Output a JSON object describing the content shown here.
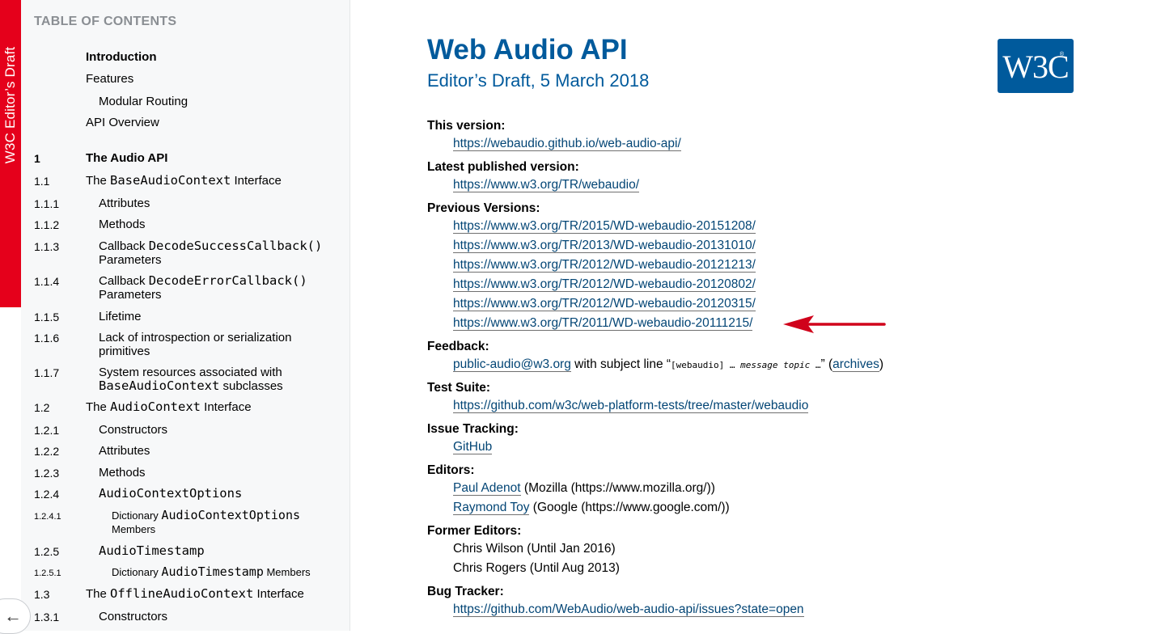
{
  "side_logo": {
    "text": "W3C Editor’s Draft",
    "color": "#e5001b"
  },
  "toc": {
    "heading": "TABLE OF CONTENTS",
    "items": [
      {
        "num": "",
        "text": "Introduction"
      },
      {
        "num": "",
        "text": "Features"
      },
      {
        "num": "",
        "text": "Modular Routing"
      },
      {
        "num": "",
        "text": "API Overview"
      },
      {
        "num": "1",
        "text": "The Audio API"
      },
      {
        "num": "1.1",
        "pre": "The ",
        "code": "BaseAudioContext",
        "post": " Interface"
      },
      {
        "num": "1.1.1",
        "text": "Attributes"
      },
      {
        "num": "1.1.2",
        "text": "Methods"
      },
      {
        "num": "1.1.3",
        "pre": "Callback ",
        "code": "DecodeSuccessCallback()",
        "post": " Parameters"
      },
      {
        "num": "1.1.4",
        "pre": "Callback ",
        "code": "DecodeErrorCallback()",
        "post": " Parameters"
      },
      {
        "num": "1.1.5",
        "text": "Lifetime"
      },
      {
        "num": "1.1.6",
        "text": "Lack of introspection or serialization primitives"
      },
      {
        "num": "1.1.7",
        "pre": "System resources associated with ",
        "code": "BaseAudioContext",
        "post": " subclasses"
      },
      {
        "num": "1.2",
        "pre": "The ",
        "code": "AudioContext",
        "post": " Interface"
      },
      {
        "num": "1.2.1",
        "text": "Constructors"
      },
      {
        "num": "1.2.2",
        "text": "Attributes"
      },
      {
        "num": "1.2.3",
        "text": "Methods"
      },
      {
        "num": "1.2.4",
        "code": "AudioContextOptions"
      },
      {
        "num": "1.2.4.1",
        "pre": "Dictionary ",
        "code": "AudioContextOptions",
        "post": " Members"
      },
      {
        "num": "1.2.5",
        "code": "AudioTimestamp"
      },
      {
        "num": "1.2.5.1",
        "pre": "Dictionary ",
        "code": "AudioTimestamp",
        "post": " Members"
      },
      {
        "num": "1.3",
        "pre": "The ",
        "code": "OfflineAudioContext",
        "post": " Interface"
      },
      {
        "num": "1.3.1",
        "text": "Constructors"
      }
    ]
  },
  "back_button": {
    "icon": "left-arrow-icon",
    "glyph": "←"
  },
  "header": {
    "title": "Web Audio API",
    "subtitle": "Editor’s Draft, 5 March 2018",
    "logo_text": "W3C",
    "logo_mark": "®",
    "accent_color": "#005a9c"
  },
  "meta": {
    "this_version": {
      "label": "This version:",
      "url": "https://webaudio.github.io/web-audio-api/"
    },
    "latest_published": {
      "label": "Latest published version:",
      "url": "https://www.w3.org/TR/webaudio/"
    },
    "previous_versions": {
      "label": "Previous Versions:",
      "urls": [
        "https://www.w3.org/TR/2015/WD-webaudio-20151208/",
        "https://www.w3.org/TR/2013/WD-webaudio-20131010/",
        "https://www.w3.org/TR/2012/WD-webaudio-20121213/",
        "https://www.w3.org/TR/2012/WD-webaudio-20120802/",
        "https://www.w3.org/TR/2012/WD-webaudio-20120315/",
        "https://www.w3.org/TR/2011/WD-webaudio-20111215/"
      ]
    },
    "feedback": {
      "label": "Feedback:",
      "email": "public-audio@w3.org",
      "text1": " with subject line “",
      "code": "[webaudio] … ",
      "code_italic": "message topic",
      "code_end": " …",
      "text2": "” (",
      "archives": "archives",
      "text3": ")"
    },
    "test_suite": {
      "label": "Test Suite:",
      "url": "https://github.com/w3c/web-platform-tests/tree/master/webaudio"
    },
    "issue_tracking": {
      "label": "Issue Tracking:",
      "link": "GitHub"
    },
    "editors": {
      "label": "Editors:",
      "people": [
        {
          "name": "Paul Adenot",
          "affiliation": " (Mozilla (https://www.mozilla.org/))"
        },
        {
          "name": "Raymond Toy",
          "affiliation": " (Google (https://www.google.com/))"
        }
      ]
    },
    "former_editors": {
      "label": "Former Editors:",
      "people": [
        "Chris Wilson (Until Jan 2016)",
        "Chris Rogers (Until Aug 2013)"
      ]
    },
    "bug_tracker": {
      "label": "Bug Tracker:",
      "url": "https://github.com/WebAudio/web-audio-api/issues?state=open"
    }
  },
  "annotation": {
    "icon": "red-arrow-icon",
    "color": "#d0021b"
  }
}
